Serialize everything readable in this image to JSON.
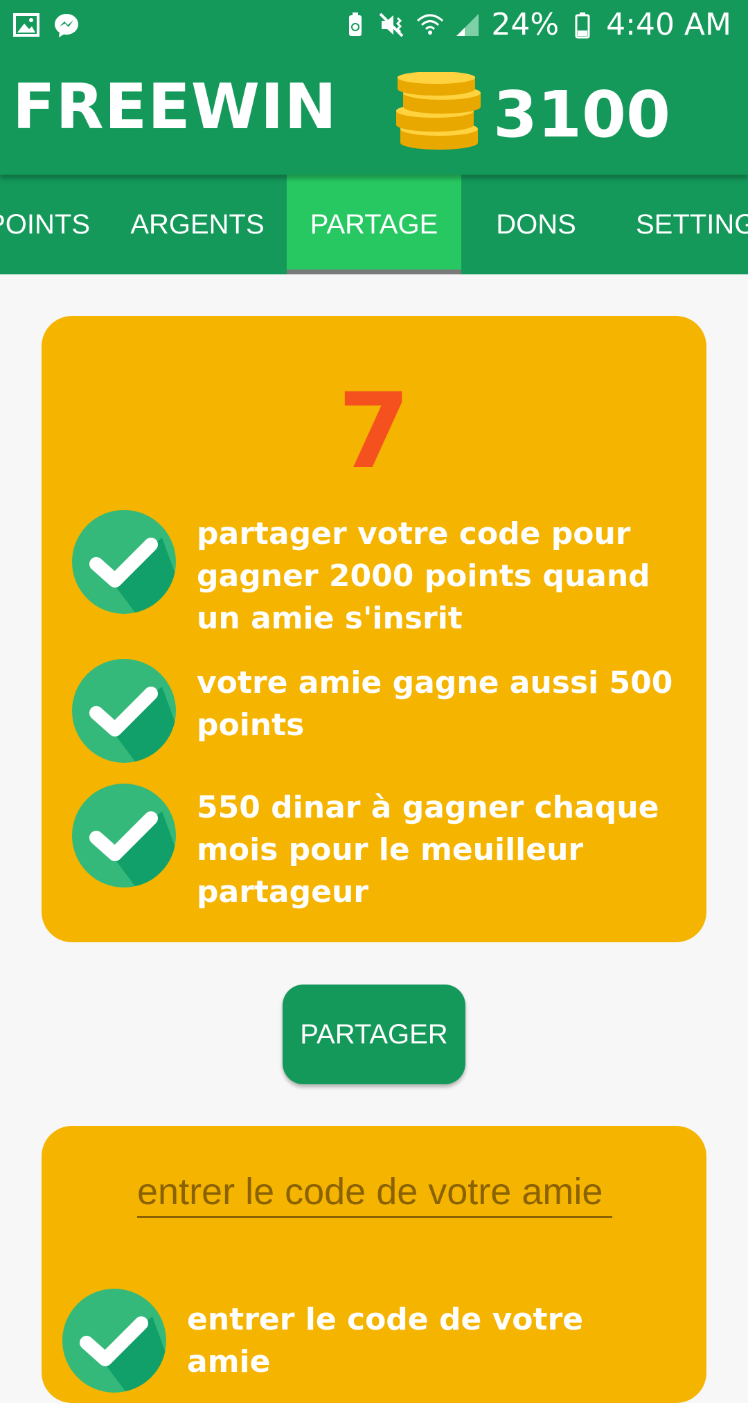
{
  "status_bar": {
    "battery": "24%",
    "time": "4:40 AM",
    "icons": [
      "image-icon",
      "messenger-icon",
      "battery-saver-icon",
      "mute-vibrate-icon",
      "wifi-icon",
      "signal-icon",
      "battery-icon"
    ]
  },
  "app": {
    "title": "FREEWIN",
    "points": "3100",
    "coins_icon": "coins-icon"
  },
  "tabs": [
    {
      "label": "POINTS"
    },
    {
      "label": "ARGENTS"
    },
    {
      "label": "PARTAGE",
      "active": true
    },
    {
      "label": "DONS"
    },
    {
      "label": "SETTINGS"
    }
  ],
  "share_card": {
    "count": "7",
    "features": [
      "partager votre code pour gagner 2000 points quand un amie s'insrit",
      "votre amie gagne aussi 500 points",
      "550 dinar à gagner chaque mois pour le meuilleur partageur"
    ]
  },
  "share_button": {
    "label": "PARTAGER"
  },
  "code_card": {
    "input_placeholder": "entrer le code de votre amie",
    "feature": "entrer le code de votre amie"
  },
  "colors": {
    "primary": "#14995a",
    "tab_active": "#27c862",
    "card": "#f5b400",
    "number": "#f4511e"
  }
}
